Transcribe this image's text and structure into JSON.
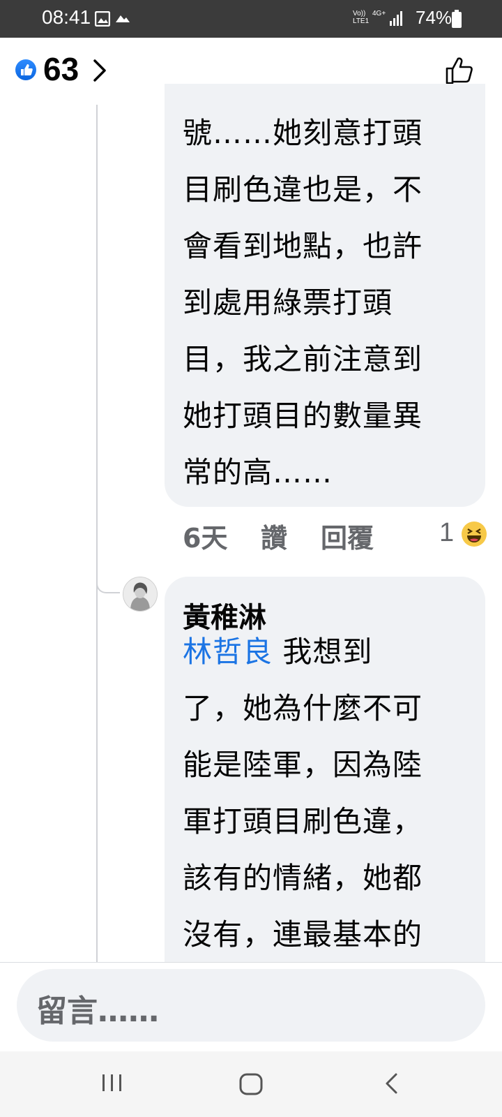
{
  "status_bar": {
    "time": "08:41",
    "network_line1": "Vo))",
    "network_line2": "LTE1",
    "network_type": "4G+",
    "battery": "74%"
  },
  "header": {
    "like_count": "63"
  },
  "comment1": {
    "lines": [
      "號……她刻意打頭",
      "目刷色違也是，不",
      "會看到地點，也許",
      "到處用綠票打頭",
      "目，我之前注意到",
      "她打頭目的數量異",
      "常的高……"
    ],
    "time": "6天",
    "like_label": "讚",
    "reply_label": "回覆",
    "reaction_count": "1"
  },
  "comment2": {
    "author": "黃稚淋",
    "mention": "林哲良",
    "first_line_rest": "我想到",
    "lines": [
      "了，她為什麼不可",
      "能是陸軍，因為陸",
      "軍打頭目刷色違，",
      "該有的情緒，她都",
      "沒有，連最基本的"
    ]
  },
  "composer": {
    "placeholder": "留言……"
  },
  "colors": {
    "like_blue": "#1b74e4",
    "bubble_bg": "#f0f2f5",
    "muted_text": "#65676b"
  }
}
